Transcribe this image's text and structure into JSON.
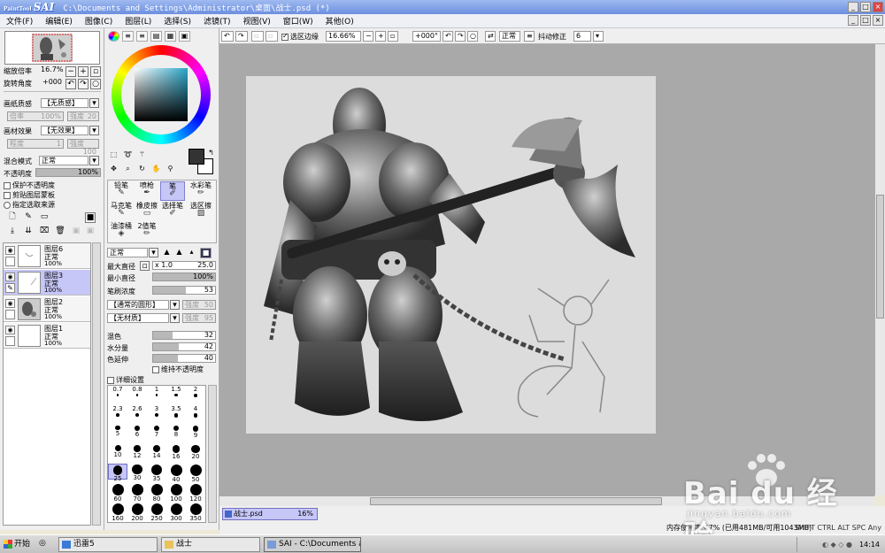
{
  "window": {
    "app_logo_small": "PaintTool",
    "app_logo": "SAI",
    "title": "C:\\Documents and Settings\\Administrator\\桌面\\战士.psd (*)"
  },
  "menu": [
    "文件(F)",
    "编辑(E)",
    "图像(C)",
    "图层(L)",
    "选择(S)",
    "滤镜(T)",
    "视图(V)",
    "窗口(W)",
    "其他(O)"
  ],
  "navigator": {
    "zoom_label": "缩放倍率",
    "zoom_value": "16.7%",
    "angle_label": "旋转角度",
    "angle_value": "+000"
  },
  "paper": {
    "texture_label": "画纸质感",
    "texture_value": "【无质感】",
    "texture_scale_label": "倍率",
    "texture_scale_value": "100%",
    "texture_strength_label": "强度",
    "texture_strength_value": "20",
    "effect_label": "画材效果",
    "effect_value": "【无效果】",
    "effect_level_label": "程度",
    "effect_level_value": "1",
    "effect_strength_label": "强度",
    "effect_strength_value": "100"
  },
  "layer_props": {
    "blend_label": "混合模式",
    "blend_value": "正常",
    "opacity_label": "不透明度",
    "opacity_value": "100%",
    "opacity_fraction": 1.0,
    "protect_opacity": "保护不透明度",
    "clip_group": "剪贴图层蒙板",
    "selection_source": "指定选取来源"
  },
  "layers": [
    {
      "name": "图层6",
      "mode": "正常",
      "opacity": "100%",
      "selected": false
    },
    {
      "name": "图层3",
      "mode": "正常",
      "opacity": "100%",
      "selected": true
    },
    {
      "name": "图层2",
      "mode": "正常",
      "opacity": "100%",
      "selected": false
    },
    {
      "name": "图层1",
      "mode": "正常",
      "opacity": "100%",
      "selected": false
    }
  ],
  "brushes": [
    {
      "label": "铅笔",
      "icon": "✎",
      "selected": false
    },
    {
      "label": "喷枪",
      "icon": "✒",
      "selected": false
    },
    {
      "label": "笔",
      "icon": "✐",
      "selected": true
    },
    {
      "label": "水彩笔",
      "icon": "✏",
      "selected": false
    },
    {
      "label": "马克笔",
      "icon": "✎",
      "selected": false
    },
    {
      "label": "橡皮擦",
      "icon": "▭",
      "selected": false
    },
    {
      "label": "选择笔",
      "icon": "✐",
      "selected": false
    },
    {
      "label": "选区擦",
      "icon": "▨",
      "selected": false
    },
    {
      "label": "油漆桶",
      "icon": "◈",
      "selected": false
    },
    {
      "label": "2值笔",
      "icon": "✏",
      "selected": false
    }
  ],
  "brush_settings": {
    "mode_value": "正常",
    "max_size_label": "最大直径",
    "size_multiplier": "x 1.0",
    "size_value": "25.0",
    "min_size_label": "最小直径",
    "min_size_value": "100%",
    "min_size_fraction": 1.0,
    "density_label": "笔刷浓度",
    "density_value": "53",
    "density_fraction": 0.53,
    "shape_value": "【通常的圆形】",
    "shape_strength_label": "强度",
    "shape_strength_value": "50",
    "texture_value": "【无材质】",
    "texture_strength_label": "强度",
    "texture_strength_value": "95",
    "blend_label": "混色",
    "blend_value": "32",
    "blend_fraction": 0.32,
    "water_label": "水分量",
    "water_value": "42",
    "water_fraction": 0.42,
    "persistence_label": "色延伸",
    "persistence_value": "40",
    "persistence_fraction": 0.4,
    "keep_opacity": "维持不透明度",
    "detail": "详细设置"
  },
  "brush_sizes": [
    "0.7",
    "0.8",
    "1",
    "1.5",
    "2",
    "2.3",
    "2.6",
    "3",
    "3.5",
    "4",
    "5",
    "6",
    "7",
    "8",
    "9",
    "10",
    "12",
    "14",
    "16",
    "20",
    "25",
    "30",
    "35",
    "40",
    "50",
    "60",
    "70",
    "80",
    "100",
    "120",
    "160",
    "200",
    "250",
    "300",
    "350"
  ],
  "selected_size": "25",
  "canvas_toolbar": {
    "selection_edge_label": "选区边缘",
    "zoom": "16.66%",
    "angle": "+000°",
    "blend": "正常",
    "stabilizer_label": "抖动修正",
    "stabilizer_value": "6"
  },
  "document_tab": {
    "name": "战士.psd",
    "zoom": "16%"
  },
  "status": {
    "memory": "内存使用率 47% (已用481MB/可用1043MB)",
    "tray": "SHIFT CTRL ALT SPC Any"
  },
  "taskbar": {
    "start": "开始",
    "tasks": [
      "迅雷5",
      "战士",
      "SAI - C:\\Documents and ..."
    ],
    "clock": "14:14"
  },
  "watermark": {
    "text": "Bai du 经验",
    "sub": "jingyan.baidu.com"
  }
}
